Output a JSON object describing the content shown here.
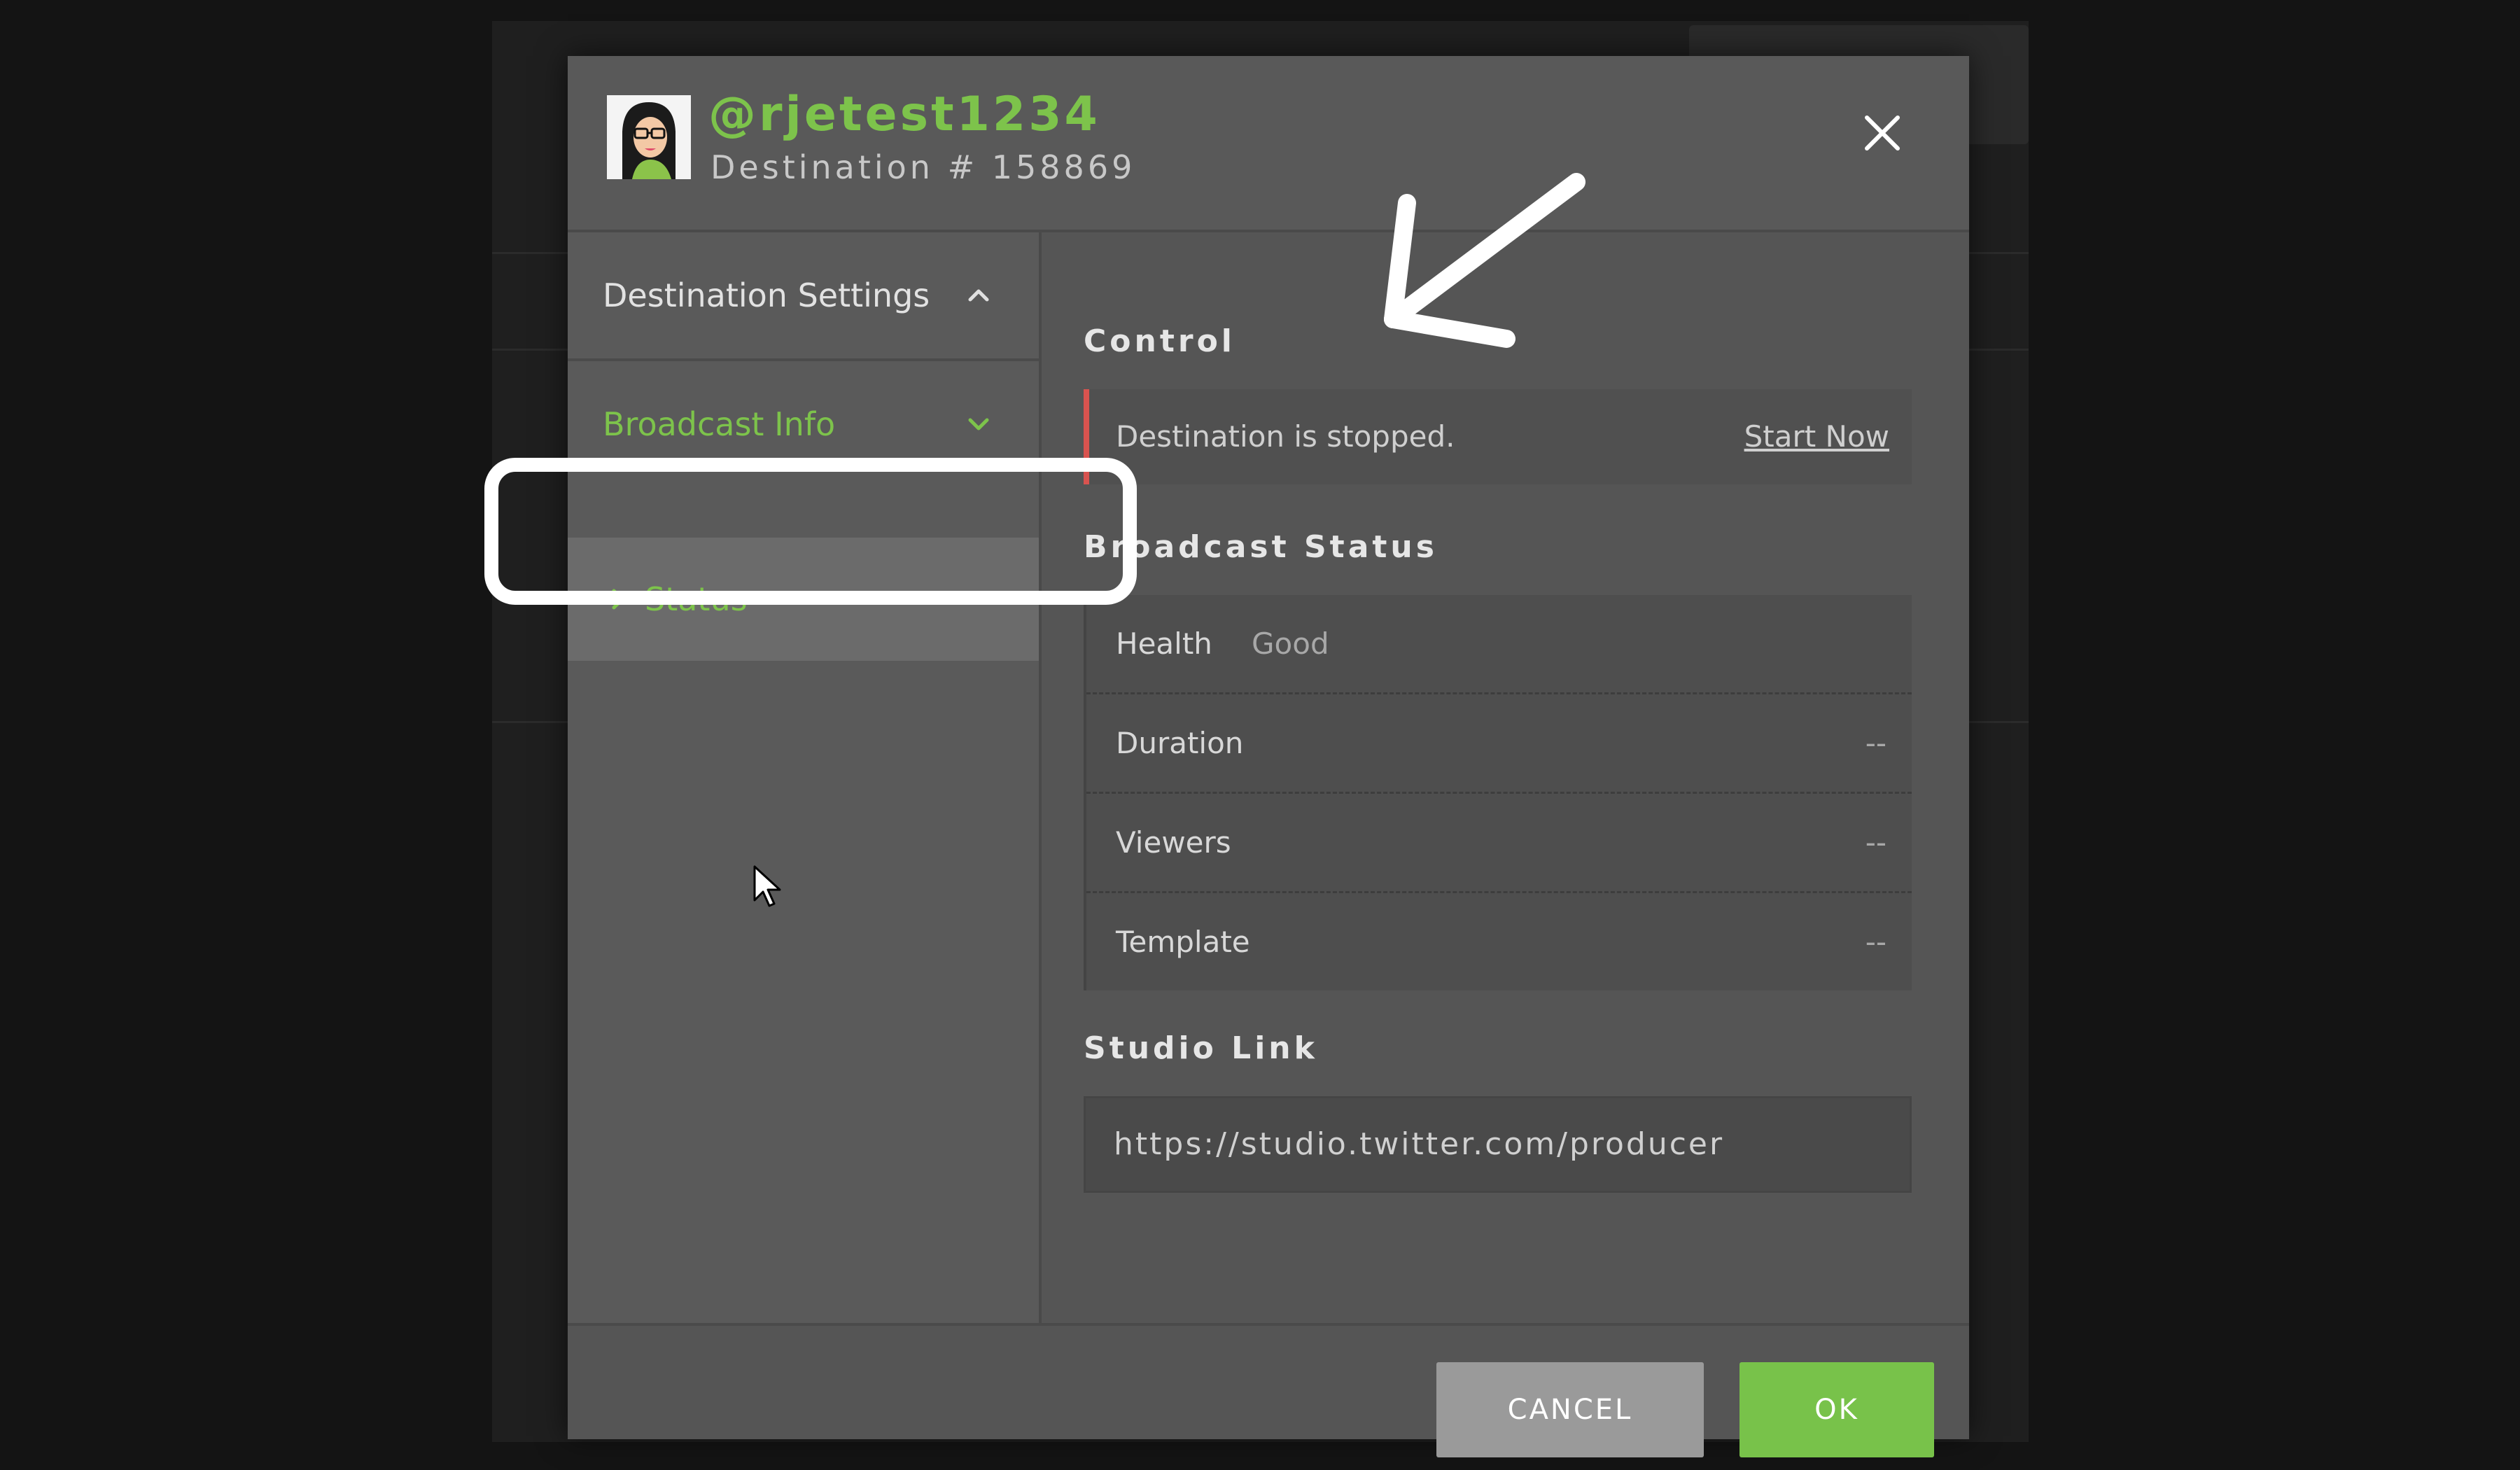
{
  "header": {
    "handle": "@rjetest1234",
    "destination": "Destination # 158869"
  },
  "sidebar": {
    "items": [
      {
        "label": "Destination Settings",
        "icon": "chevron-up-icon",
        "active": false
      },
      {
        "label": "Broadcast Info",
        "icon": "chevron-down-icon",
        "active": true
      }
    ],
    "sub_item": {
      "label": "Status",
      "icon": "chevron-right-icon"
    }
  },
  "control": {
    "title": "Control",
    "message": "Destination is stopped.",
    "action": "Start Now",
    "status_color": "#d9534f"
  },
  "broadcast_status": {
    "title": "Broadcast Status",
    "rows": [
      {
        "label": "Health",
        "value": "Good"
      },
      {
        "label": "Duration",
        "value": "--"
      },
      {
        "label": "Viewers",
        "value": "--"
      },
      {
        "label": "Template",
        "value": "--"
      }
    ]
  },
  "studio_link": {
    "title": "Studio Link",
    "url": "https://studio.twitter.com/producer"
  },
  "footer": {
    "cancel_label": "CANCEL",
    "ok_label": "OK"
  },
  "colors": {
    "accent": "#7dc34b",
    "ok_button": "#78c24a",
    "cancel_button": "#9a9a9a"
  }
}
